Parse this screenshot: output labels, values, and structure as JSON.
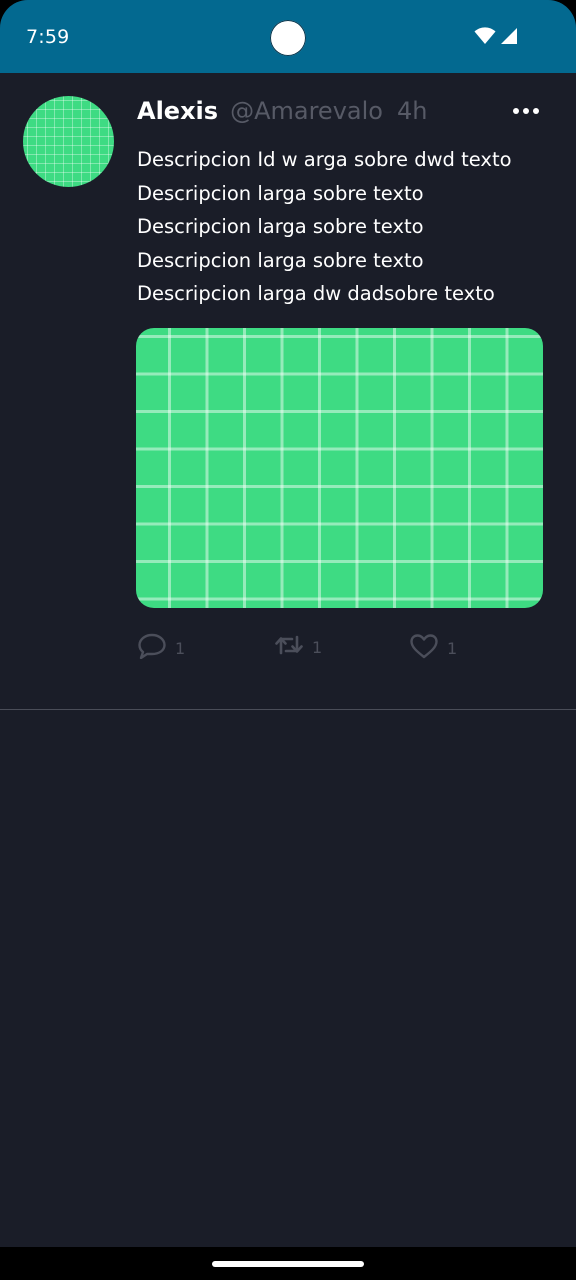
{
  "status_bar": {
    "time": "7:59",
    "icons": [
      "wifi-icon",
      "cellular-signal-icon"
    ]
  },
  "tweet": {
    "author_name": "Alexis",
    "handle": "@Amarevalo",
    "timestamp": "4h",
    "text_lines": [
      "Descripcion Id w arga sobre dwd texto",
      "Descripcion larga sobre texto",
      "Descripcion larga sobre texto",
      "Descripcion larga sobre texto",
      "Descripcion larga dw dadsobre texto"
    ],
    "actions": {
      "reply_count": "1",
      "retweet_count": "1",
      "like_count": "1"
    }
  },
  "colors": {
    "status_bar": "#036990",
    "background": "#1a1d28",
    "placeholder_green": "#3edb83",
    "muted_text": "#575a66",
    "divider": "#4a4d58"
  }
}
